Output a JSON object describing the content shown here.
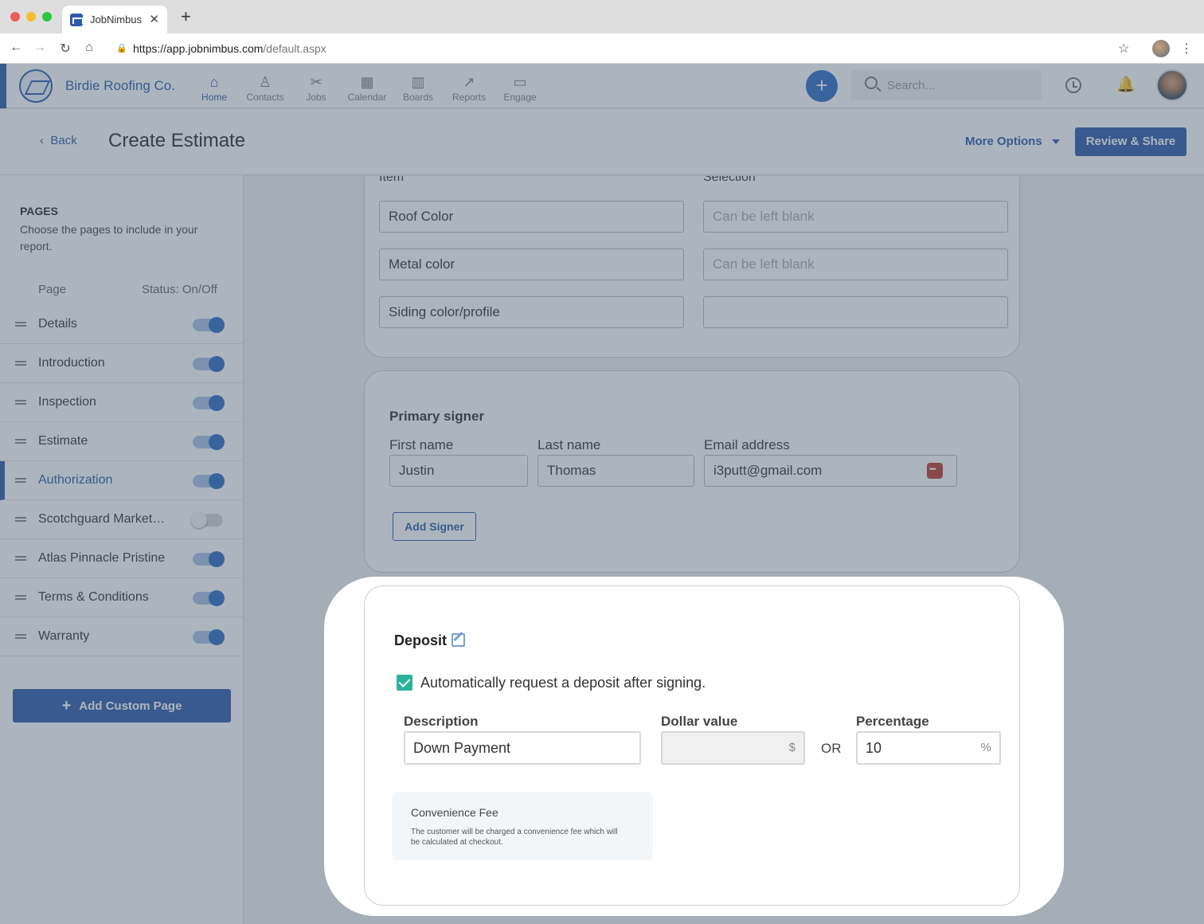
{
  "browser": {
    "tab_title": "JobNimbus",
    "url_main": "https://app.jobnimbus.com",
    "url_path": "/default.aspx"
  },
  "header": {
    "company": "Birdie Roofing Co.",
    "nav": [
      {
        "label": "Home",
        "icon": "home-icon"
      },
      {
        "label": "Contacts",
        "icon": "person-icon"
      },
      {
        "label": "Jobs",
        "icon": "tools-icon"
      },
      {
        "label": "Calendar",
        "icon": "calendar-icon"
      },
      {
        "label": "Boards",
        "icon": "boards-icon"
      },
      {
        "label": "Reports",
        "icon": "reports-icon"
      },
      {
        "label": "Engage",
        "icon": "chat-icon"
      }
    ],
    "search_placeholder": "Search..."
  },
  "subheader": {
    "back": "Back",
    "title": "Create Estimate",
    "more_options": "More Options",
    "review_share": "Review & Share"
  },
  "sidebar": {
    "heading": "PAGES",
    "description": "Choose the pages to include in your report.",
    "col_page": "Page",
    "col_status": "Status: On/Off",
    "pages": [
      {
        "name": "Details",
        "on": true
      },
      {
        "name": "Introduction",
        "on": true
      },
      {
        "name": "Inspection",
        "on": true
      },
      {
        "name": "Estimate",
        "on": true
      },
      {
        "name": "Authorization",
        "on": true,
        "active": true
      },
      {
        "name": "Scotchguard Marketing",
        "on": false
      },
      {
        "name": "Atlas Pinnacle Pristine",
        "on": true
      },
      {
        "name": "Terms & Conditions",
        "on": true
      },
      {
        "name": "Warranty",
        "on": true
      }
    ],
    "add_custom_page": "Add Custom Page"
  },
  "selections": {
    "col_item": "Item",
    "col_selection": "Selection",
    "rows": [
      {
        "item": "Roof Color",
        "selection_placeholder": "Can be left blank"
      },
      {
        "item": "Metal color",
        "selection_placeholder": "Can be left blank"
      },
      {
        "item": "Siding color/profile",
        "selection_placeholder": ""
      }
    ]
  },
  "signer": {
    "title": "Primary signer",
    "first_name_label": "First name",
    "last_name_label": "Last name",
    "email_label": "Email address",
    "first_name": "Justin",
    "last_name": "Thomas",
    "email": "i3putt@gmail.com",
    "add_signer": "Add Signer"
  },
  "deposit": {
    "title": "Deposit",
    "auto_request_label": "Automatically request a deposit after signing.",
    "auto_request_checked": true,
    "description_label": "Description",
    "description_value": "Down Payment",
    "dollar_label": "Dollar value",
    "dollar_suffix": "$",
    "or_text": "OR",
    "percentage_label": "Percentage",
    "percentage_value": "10",
    "percentage_suffix": "%",
    "fee_title": "Convenience Fee",
    "fee_desc": "The customer will be charged a convenience fee which will be calculated at checkout."
  },
  "colors": {
    "brand": "#2e5aa8",
    "check": "#2bb39a"
  }
}
